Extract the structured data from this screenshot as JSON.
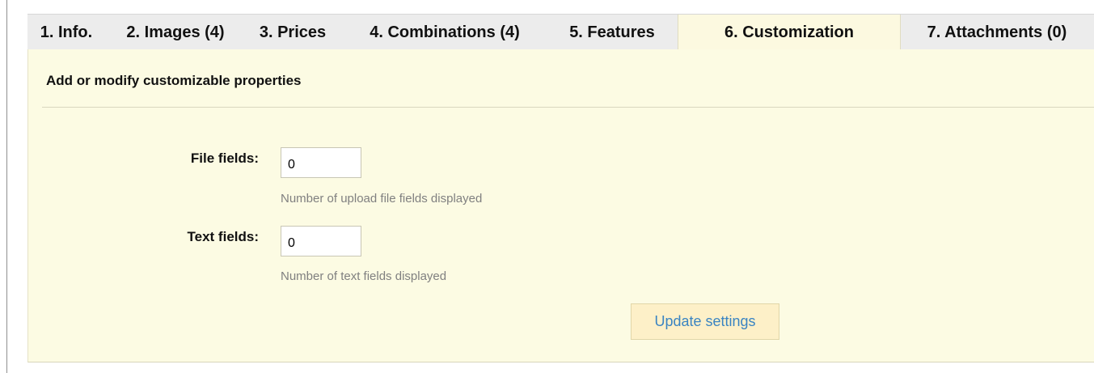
{
  "tabs": [
    {
      "label": "1. Info."
    },
    {
      "label": "2. Images (4)"
    },
    {
      "label": "3. Prices"
    },
    {
      "label": "4. Combinations (4)"
    },
    {
      "label": "5. Features"
    },
    {
      "label": "6. Customization",
      "active": true
    },
    {
      "label": "7. Attachments (0)"
    }
  ],
  "panel": {
    "title": "Add or modify customizable properties",
    "file_fields": {
      "label": "File fields:",
      "value": "0",
      "hint": "Number of upload file fields displayed"
    },
    "text_fields": {
      "label": "Text fields:",
      "value": "0",
      "hint": "Number of text fields displayed"
    },
    "update_button": "Update settings"
  },
  "colors": {
    "panel_bg": "#fcfbe3",
    "active_tab_bg": "#fcf9e0",
    "tab_bar_bg": "#ececec",
    "button_text": "#3a84c2",
    "button_bg": "#fdf0c8"
  }
}
